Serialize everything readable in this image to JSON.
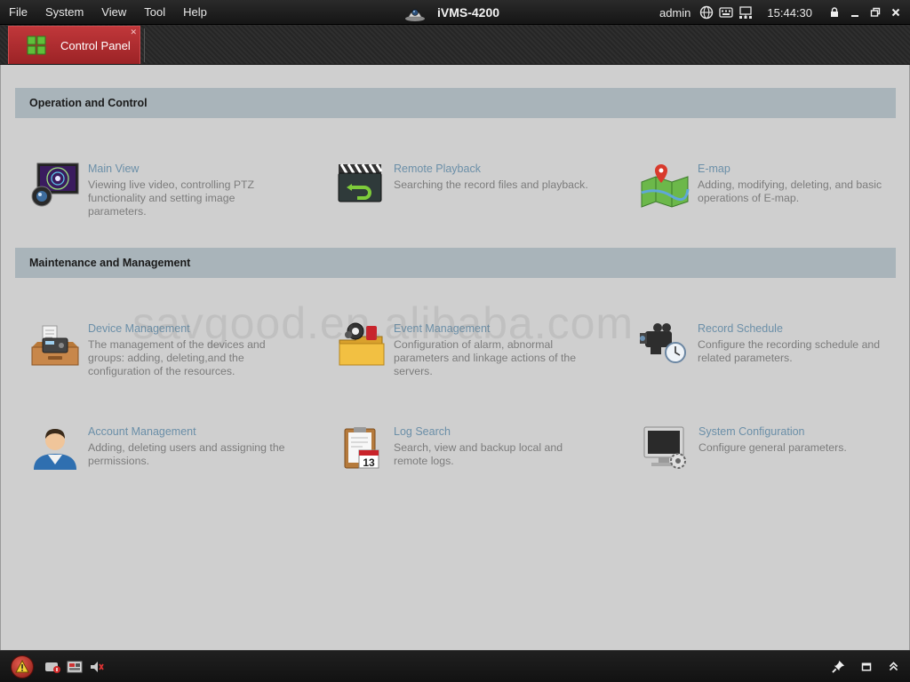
{
  "menubar": {
    "items": [
      "File",
      "System",
      "View",
      "Tool",
      "Help"
    ],
    "app_title": "iVMS-4200",
    "user": "admin",
    "clock": "15:44:30",
    "tray_icons": [
      "globe-icon",
      "keyboard-icon",
      "network-icon"
    ],
    "window_controls": [
      "lock-icon",
      "minimize-icon",
      "restore-icon",
      "close-icon"
    ]
  },
  "tabs": [
    {
      "label": "Control Panel",
      "icon": "control-panel-grid-icon",
      "active": true
    }
  ],
  "sections": [
    {
      "title": "Operation and Control",
      "modules": [
        {
          "title": "Main View",
          "desc": "Viewing live video, controlling PTZ functionality and setting image parameters.",
          "icon": "main-view-icon"
        },
        {
          "title": "Remote Playback",
          "desc": "Searching the record files and playback.",
          "icon": "remote-playback-icon"
        },
        {
          "title": "E-map",
          "desc": "Adding, modifying, deleting, and basic operations of E-map.",
          "icon": "emap-icon"
        }
      ]
    },
    {
      "title": "Maintenance and Management",
      "modules": [
        {
          "title": "Device Management",
          "desc": "The management of the devices and groups: adding, deleting,and the configuration of the resources.",
          "icon": "device-management-icon"
        },
        {
          "title": "Event Management",
          "desc": "Configuration of alarm, abnormal parameters and linkage actions of the servers.",
          "icon": "event-management-icon"
        },
        {
          "title": "Record Schedule",
          "desc": "Configure the recording schedule and related parameters.",
          "icon": "record-schedule-icon"
        },
        {
          "title": "Account Management",
          "desc": "Adding, deleting users and assigning the permissions.",
          "icon": "account-management-icon"
        },
        {
          "title": "Log Search",
          "desc": "Search, view and backup local and remote logs.",
          "icon": "log-search-icon",
          "calendar_day": "13"
        },
        {
          "title": "System Configuration",
          "desc": "Configure general parameters.",
          "icon": "system-configuration-icon"
        }
      ]
    }
  ],
  "watermark": "savgood.en.alibaba.com",
  "statusbar": {
    "left_icons": [
      "alarm-warning-icon",
      "alarm-device-icon",
      "alarm-video-icon",
      "mute-sound-icon"
    ],
    "right_icons": [
      "pin-icon",
      "fullscreen-icon",
      "collapse-up-icon"
    ]
  }
}
